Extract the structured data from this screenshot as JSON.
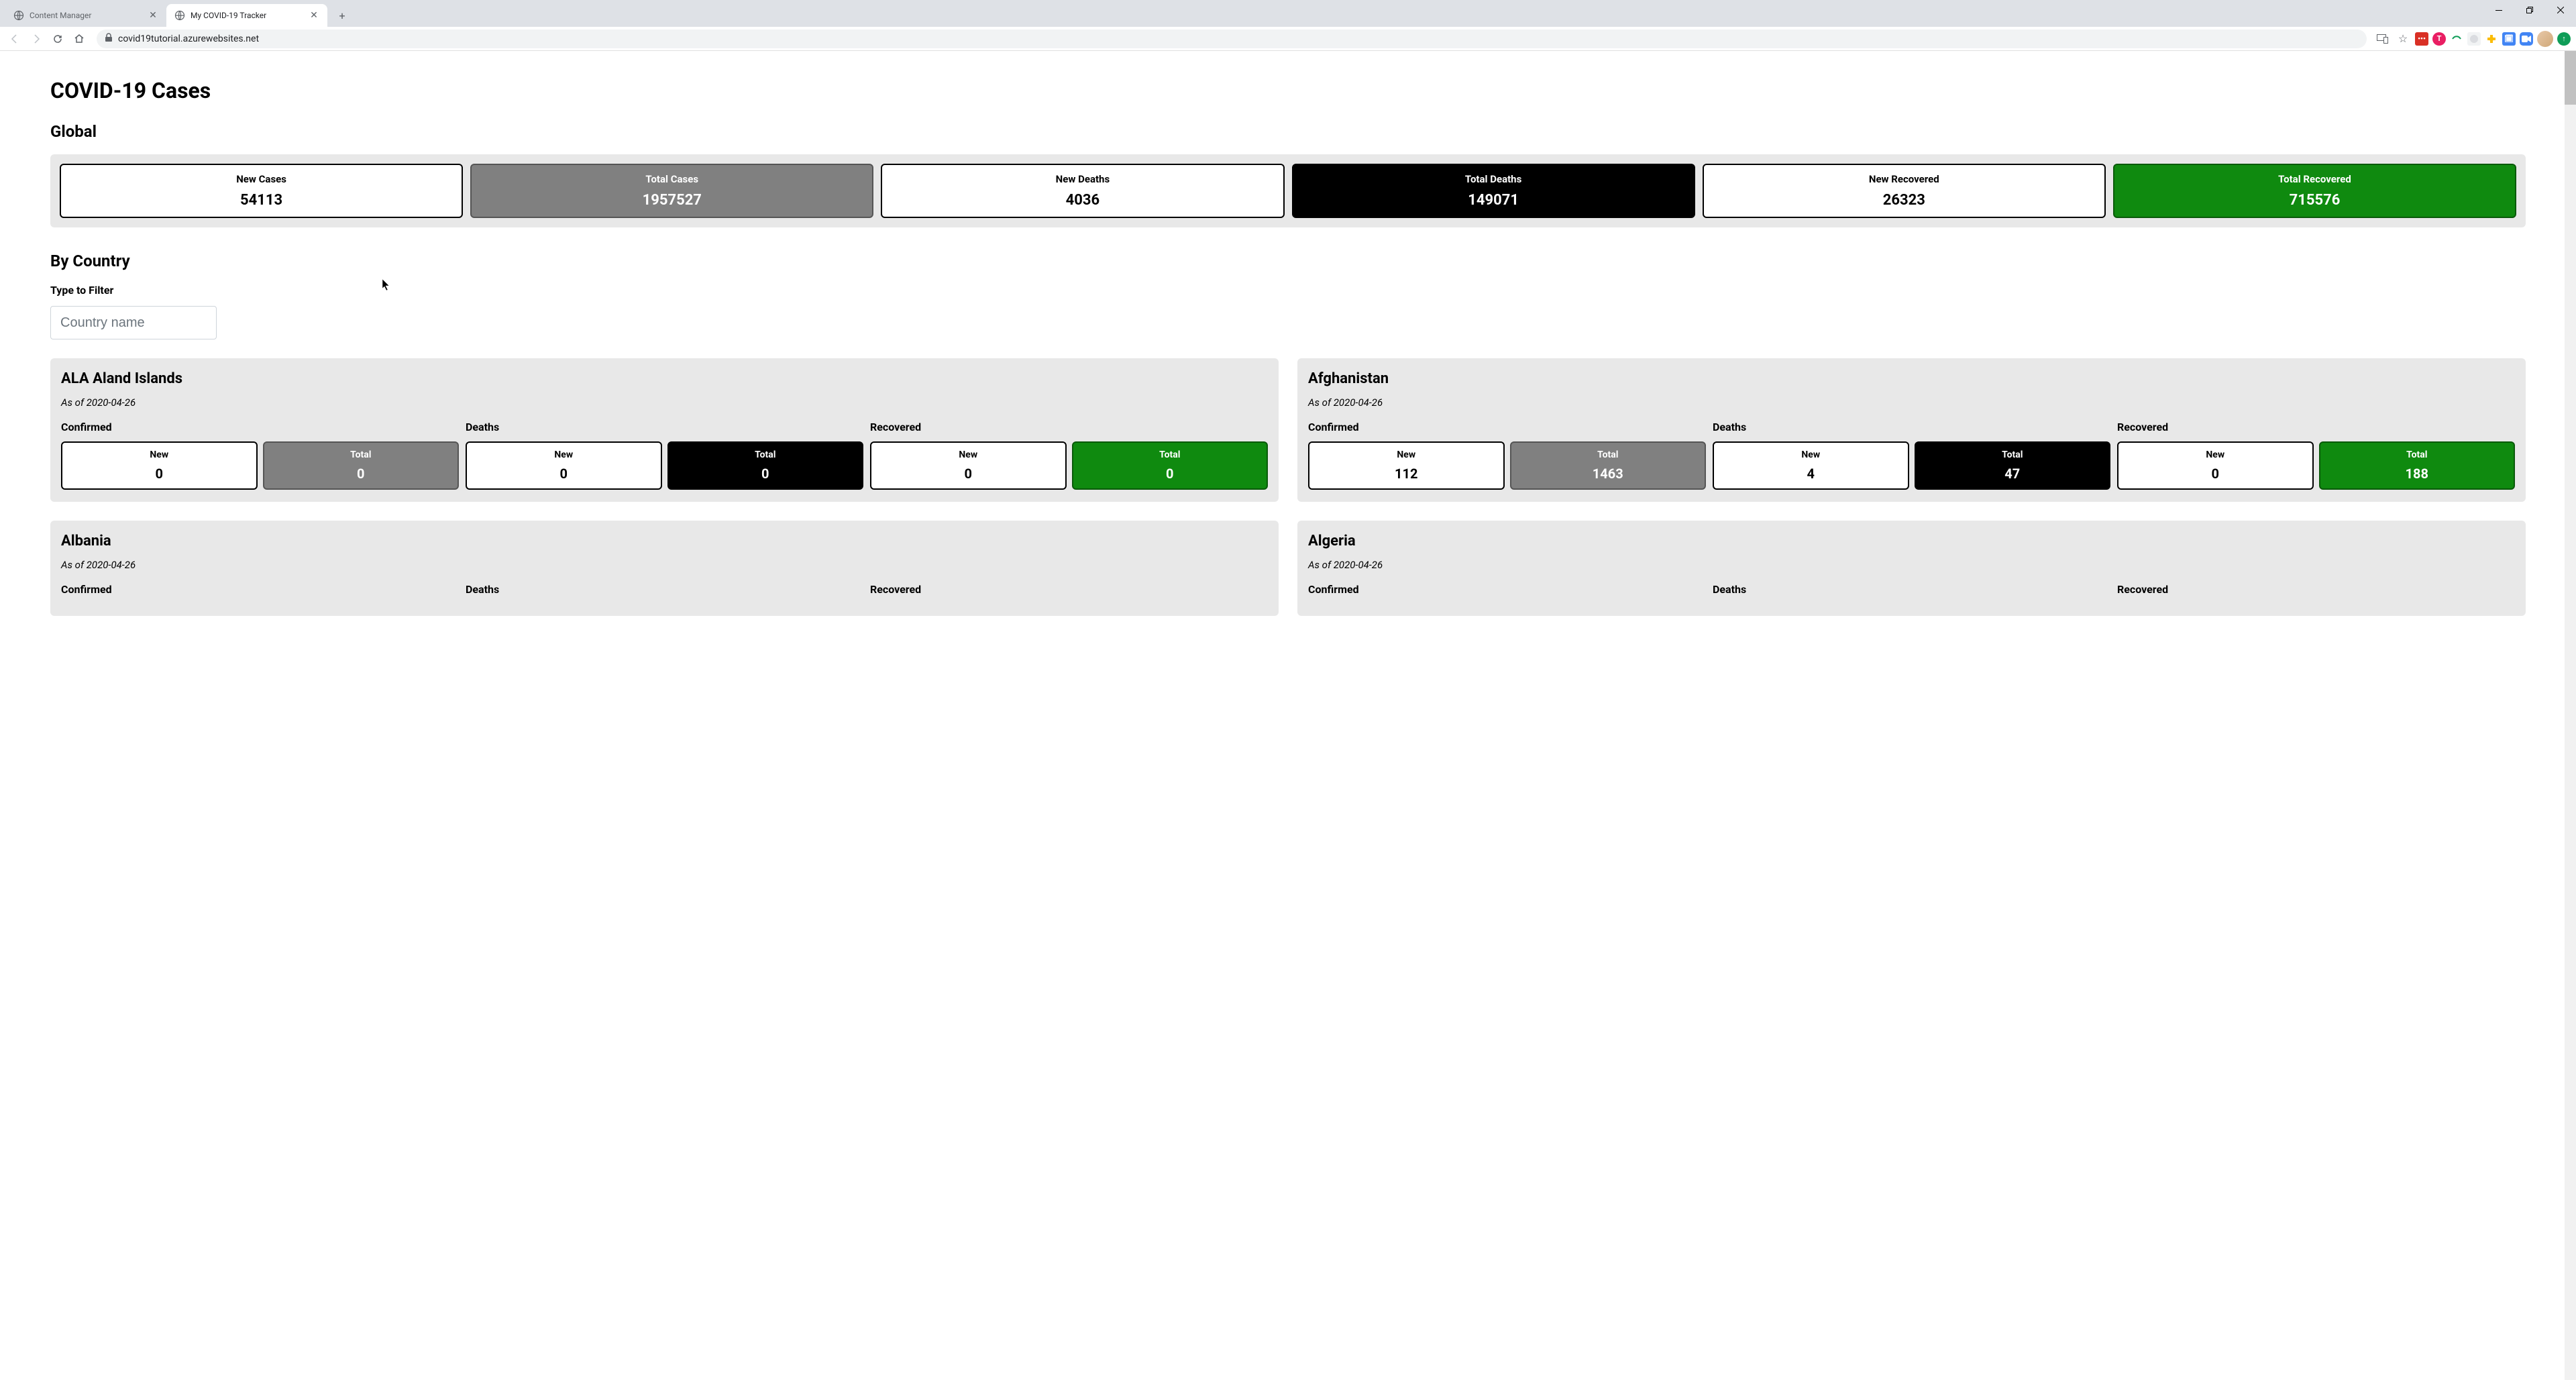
{
  "browser": {
    "tabs": [
      {
        "title": "Content Manager",
        "active": false
      },
      {
        "title": "My COVID-19 Tracker",
        "active": true
      }
    ],
    "url": "covid19tutorial.azurewebsites.net"
  },
  "page": {
    "title": "COVID-19 Cases",
    "global_heading": "Global",
    "global_stats": [
      {
        "label": "New Cases",
        "value": "54113",
        "style": "white"
      },
      {
        "label": "Total Cases",
        "value": "1957527",
        "style": "gray"
      },
      {
        "label": "New Deaths",
        "value": "4036",
        "style": "white"
      },
      {
        "label": "Total Deaths",
        "value": "149071",
        "style": "black"
      },
      {
        "label": "New Recovered",
        "value": "26323",
        "style": "white"
      },
      {
        "label": "Total Recovered",
        "value": "715576",
        "style": "green"
      }
    ],
    "by_country_heading": "By Country",
    "filter_label": "Type to Filter",
    "filter_placeholder": "Country name",
    "metric_labels": {
      "confirmed": "Confirmed",
      "deaths": "Deaths",
      "recovered": "Recovered",
      "new": "New",
      "total": "Total"
    },
    "countries": [
      {
        "name": "ALA Aland Islands",
        "date": "As of 2020-04-26",
        "confirmed": {
          "new": "0",
          "total": "0"
        },
        "deaths": {
          "new": "0",
          "total": "0"
        },
        "recovered": {
          "new": "0",
          "total": "0"
        }
      },
      {
        "name": "Afghanistan",
        "date": "As of 2020-04-26",
        "confirmed": {
          "new": "112",
          "total": "1463"
        },
        "deaths": {
          "new": "4",
          "total": "47"
        },
        "recovered": {
          "new": "0",
          "total": "188"
        }
      },
      {
        "name": "Albania",
        "date": "As of 2020-04-26",
        "confirmed": {
          "new": "",
          "total": ""
        },
        "deaths": {
          "new": "",
          "total": ""
        },
        "recovered": {
          "new": "",
          "total": ""
        }
      },
      {
        "name": "Algeria",
        "date": "As of 2020-04-26",
        "confirmed": {
          "new": "",
          "total": ""
        },
        "deaths": {
          "new": "",
          "total": ""
        },
        "recovered": {
          "new": "",
          "total": ""
        }
      }
    ]
  }
}
